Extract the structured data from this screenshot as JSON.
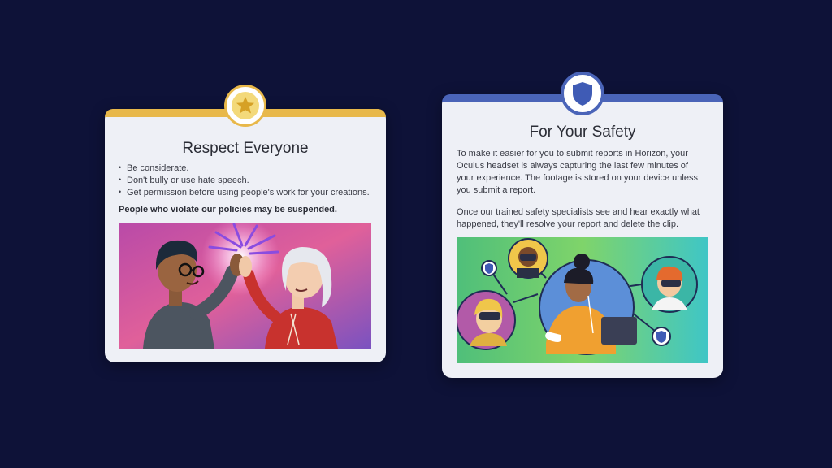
{
  "respect_card": {
    "title": "Respect Everyone",
    "bullets": [
      "Be considerate.",
      "Don't bully or use hate speech.",
      "Get permission before using people's work for your creations."
    ],
    "warning": "People who violate our policies may be suspended.",
    "icon": "star-icon",
    "accent_color": "#e8b84a"
  },
  "safety_card": {
    "title": "For Your Safety",
    "paragraph1": "To make it easier for you to submit reports in Horizon, your Oculus headset is always capturing the last few minutes of your experience. The footage is stored on your device unless you submit a report.",
    "paragraph2": "Once our trained safety specialists see and hear exactly what happened, they'll resolve your report and delete the clip.",
    "icon": "shield-icon",
    "accent_color": "#4a64b8"
  },
  "background_color": "#0e1238"
}
